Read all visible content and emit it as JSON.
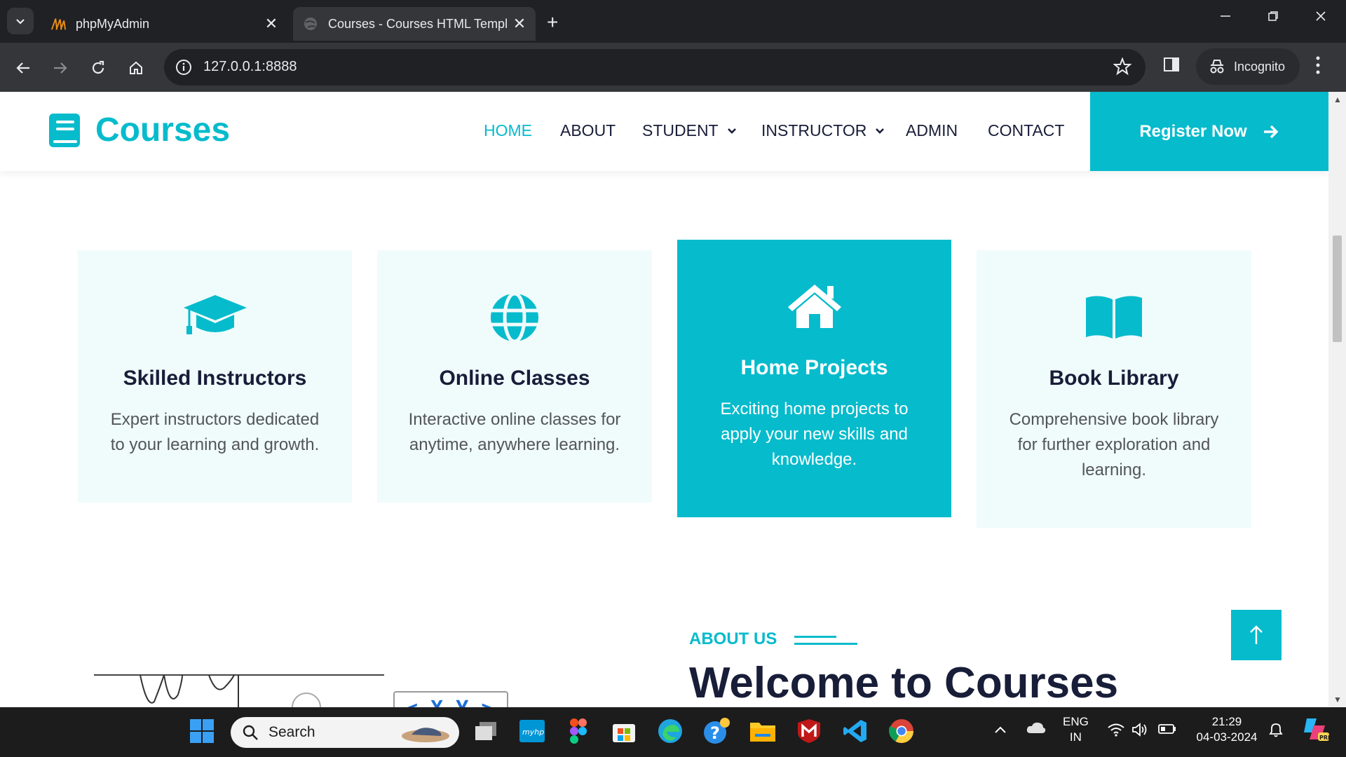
{
  "browser": {
    "tabs": [
      {
        "title": "phpMyAdmin",
        "active": false
      },
      {
        "title": "Courses - Courses HTML Templ",
        "active": true
      }
    ],
    "url": "127.0.0.1:8888",
    "profile_label": "Incognito"
  },
  "site": {
    "brand": "Courses",
    "accent_color": "#06bbcc",
    "dark_color": "#181d38",
    "nav": [
      {
        "label": "HOME",
        "active": true
      },
      {
        "label": "ABOUT"
      },
      {
        "label": "STUDENT",
        "dropdown": true
      },
      {
        "label": "INSTRUCTOR",
        "dropdown": true
      },
      {
        "label": "ADMIN"
      },
      {
        "label": "CONTACT"
      }
    ],
    "register_label": "Register Now"
  },
  "services": [
    {
      "icon": "graduation-cap-icon",
      "title": "Skilled Instructors",
      "desc_lines": [
        "Expert instructors dedicated",
        "to your learning and growth."
      ]
    },
    {
      "icon": "globe-icon",
      "title": "Online Classes",
      "desc_lines": [
        "Interactive online classes for",
        "anytime, anywhere learning."
      ]
    },
    {
      "icon": "home-icon",
      "title": "Home Projects",
      "desc_lines": [
        "Exciting home projects to",
        "apply your new skills and",
        "knowledge."
      ],
      "featured": true
    },
    {
      "icon": "book-open-icon",
      "title": "Book Library",
      "desc_lines": [
        "Comprehensive book library",
        "for further exploration and",
        "learning."
      ]
    }
  ],
  "about": {
    "label": "ABOUT US",
    "heading": "Welcome to Courses"
  },
  "taskbar": {
    "search_placeholder": "Search",
    "lang_top": "ENG",
    "lang_bottom": "IN",
    "time": "21:29",
    "date": "04-03-2024"
  }
}
